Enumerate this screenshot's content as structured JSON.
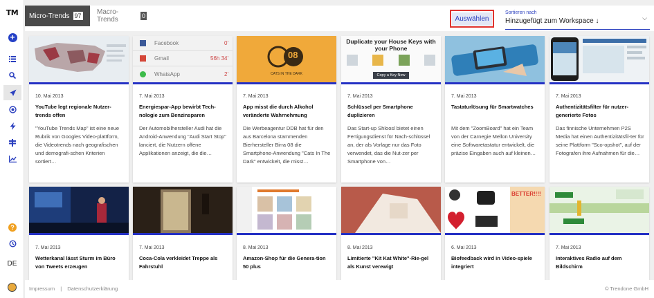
{
  "app": {
    "logo": "TM",
    "language": "DE"
  },
  "tabs": [
    {
      "label": "Micro-Trends",
      "count": "97"
    },
    {
      "label": "Macro-Trends",
      "count": "0"
    }
  ],
  "toolbar": {
    "select_label": "Auswählen",
    "sort_label": "Sortieren nach",
    "sort_value": "Hinzugefügt zum Workspace",
    "sort_arrow": "↓"
  },
  "sidebar_icons": [
    "add-icon",
    "list-icon",
    "search-icon",
    "rocket-icon",
    "target-icon",
    "bolt-icon",
    "pin-icon",
    "chart-icon",
    "help-icon",
    "history-icon"
  ],
  "colors": {
    "accent": "#2a3fbf",
    "highlight": "#e0332e",
    "card_bar": "#2430c4"
  },
  "cards": [
    {
      "date": "10. Mai 2013",
      "title": "YouTube legt regionale Nutzer-trends offen",
      "desc": "\"YouTube Trends Map\" ist eine neue Rubrik von Googles Video-plattform, die Videotrends nach geografischen und demografi-schen Kriterien sortiert…"
    },
    {
      "date": "7. Mai 2013",
      "title": "Energiespar-App bewirbt Tech-nologie zum Benzinsparen",
      "desc": "Der Automobilhersteller Audi hat die Android-Anwendung \"Audi Start Stop\" lanciert, die Nutzern offene Applikationen anzeigt, die die…",
      "thumb": {
        "rows": [
          {
            "name": "Facebook",
            "value": "0'"
          },
          {
            "name": "Gmail",
            "value": "56h 34'"
          },
          {
            "name": "WhatsApp",
            "value": "2'"
          }
        ]
      }
    },
    {
      "date": "7. Mai 2013",
      "title": "App misst die durch Alkohol veränderte Wahrnehmung",
      "desc": "Die Werbeagentur DDB hat für den aus Barcelona stammenden Bierhersteller Birra 08 die Smartphone-Anwendung \"Cats In The Dark\" entwickelt, die misst…",
      "thumb": {
        "logo": "08",
        "caption": "CATS IN THE DARK"
      }
    },
    {
      "date": "7. Mai 2013",
      "title": "Schlüssel per Smartphone duplizieren",
      "desc": "Das Start-up Shloosl bietet einen Fertigungsdienst für Nach-schlüssel an, der als Vorlage nur das Foto verwendet, das die Nut-zer per Smartphone von…",
      "thumb": {
        "headline": "Duplicate your House Keys with your Phone",
        "button": "Copy a Key Now"
      }
    },
    {
      "date": "7. Mai 2013",
      "title": "Tastaturlösung für Smartwatches",
      "desc": "Mit dem \"ZoomBoard\" hat ein Team von der Carnegie Mellon University eine Softwaretastatur entwickelt, die präzise Eingaben auch auf kleinen…"
    },
    {
      "date": "7. Mai 2013",
      "title": "Authentizitätsfilter für nutzer-generierte Fotos",
      "desc": "Das finnische Unternehmen P2S Media hat einen Authentizitätsfil-ter für seine Plattform \"Sco-opshot\", auf der Fotografen ihre Aufnahmen für die…"
    },
    {
      "date": "7. Mai 2013",
      "title": "Wetterkanal lässt Sturm im Büro von Tweets erzeugen"
    },
    {
      "date": "7. Mai 2013",
      "title": "Coca-Cola verkleidet Treppe als Fahrstuhl"
    },
    {
      "date": "8. Mai 2013",
      "title": "Amazon-Shop für die Genera-tion 50 plus"
    },
    {
      "date": "8. Mai 2013",
      "title": "Limitierte \"Kit Kat White\"-Rie-gel als Kunst verewigt"
    },
    {
      "date": "6. Mai 2013",
      "title": "Biofeedback wird in Video-spiele integriert",
      "thumb": {
        "text": "BETTER!!!!"
      }
    },
    {
      "date": "7. Mai 2013",
      "title": "Interaktives Radio auf dem Bildschirm"
    }
  ],
  "footer": {
    "impressum": "Impressum",
    "separator": "|",
    "privacy": "Datenschutzerklärung",
    "copyright": "© Trendone GmbH"
  }
}
